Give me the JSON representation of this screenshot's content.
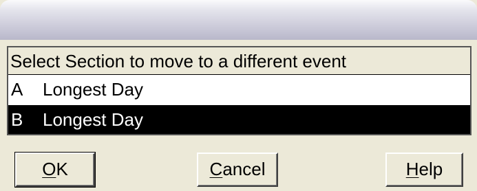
{
  "dialog": {
    "title": ""
  },
  "list": {
    "header": "Select Section to move to a different event",
    "items": [
      {
        "letter": "A",
        "name": "Longest Day",
        "selected": false
      },
      {
        "letter": "B",
        "name": "Longest Day",
        "selected": true
      }
    ]
  },
  "buttons": {
    "ok": {
      "mnemonic": "O",
      "rest": "K"
    },
    "cancel": {
      "mnemonic": "C",
      "rest": "ancel"
    },
    "help": {
      "mnemonic": "H",
      "rest": "elp"
    }
  },
  "colors": {
    "face": "#ece9d8",
    "selection": "#000000",
    "selection_text": "#ffffff"
  }
}
